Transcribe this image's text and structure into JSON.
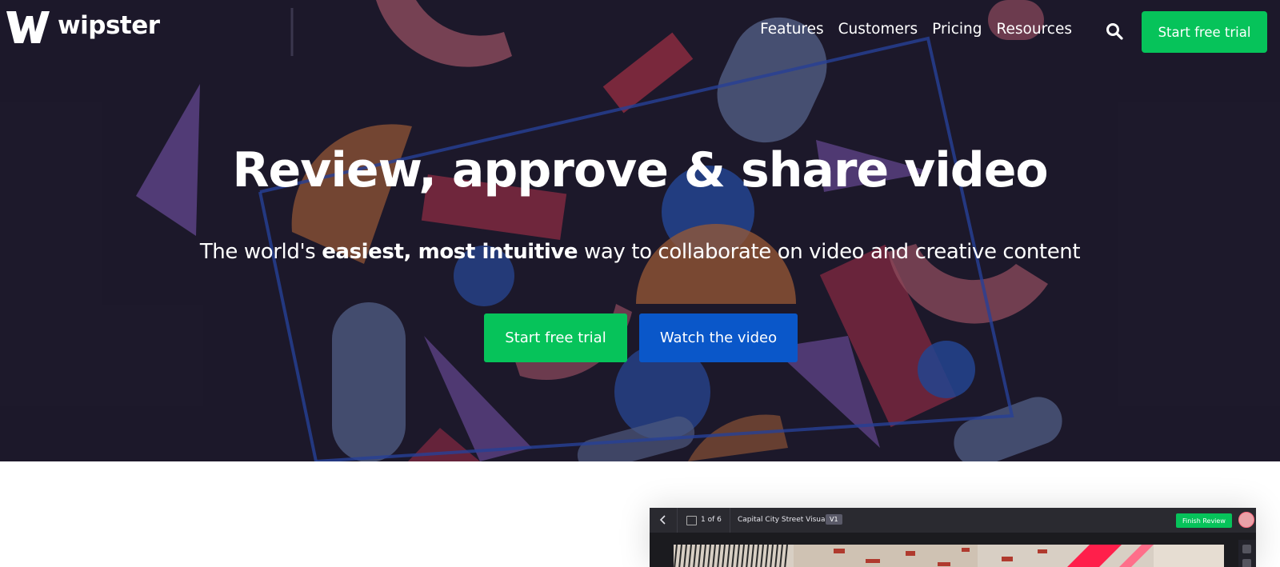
{
  "brand": {
    "name": "wipster",
    "logo_icon": "wipster-w-logo"
  },
  "nav": {
    "links": [
      "Features",
      "Customers",
      "Pricing",
      "Resources"
    ],
    "search_icon": "search-icon",
    "cta_label": "Start free trial"
  },
  "hero": {
    "headline": "Review, approve & share video",
    "sub_pre": "The world's ",
    "sub_bold": "easiest, most intuitive",
    "sub_post": " way to collaborate on video and creative content",
    "primary_cta": "Start free trial",
    "secondary_cta": "Watch the video"
  },
  "preview": {
    "page_indicator": "1 of 6",
    "project_title": "Capital City Street Visuals",
    "version_badge": "V1",
    "finish_label": "Finish Review"
  },
  "colors": {
    "hero_bg": "#1e1a2d",
    "green": "#06c35a",
    "blue": "#0a57c9"
  }
}
